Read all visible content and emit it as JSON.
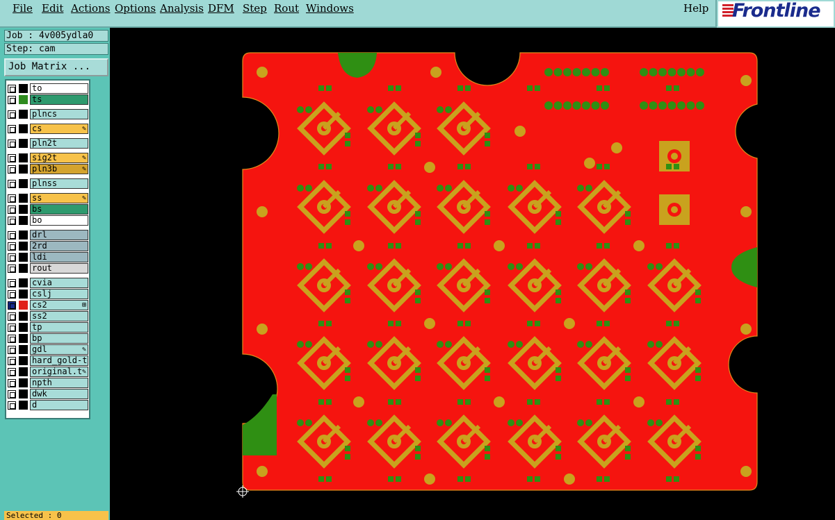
{
  "menu": [
    "File",
    "Edit",
    "Actions",
    "Options",
    "Analysis",
    "DFM",
    "Step",
    "Rout",
    "Windows"
  ],
  "help": "Help",
  "brand": "Frontline",
  "job": "Job : 4v005ydla0",
  "step": "Step: cam",
  "job_matrix": "Job Matrix ...",
  "selected": "Selected : 0",
  "layers": [
    {
      "name": "to",
      "bg": "#ffffff",
      "swatch": "#000000"
    },
    {
      "name": "ts",
      "bg": "#2e9a6e",
      "swatch": "#2e8b1e"
    },
    {
      "name": "plncs",
      "bg": "#a8dcd8",
      "swatch": "#000000"
    },
    {
      "name": "cs",
      "bg": "#f7c24a",
      "swatch": "#000000",
      "mark": "✎"
    },
    {
      "name": "pln2t",
      "bg": "#a8dcd8",
      "swatch": "#000000"
    },
    {
      "name": "sig2t",
      "bg": "#f7c24a",
      "swatch": "#000000",
      "mark": "✎"
    },
    {
      "name": "pln3b",
      "bg": "#d4a32e",
      "swatch": "#000000",
      "mark": "✎"
    },
    {
      "name": "plnss",
      "bg": "#a8dcd8",
      "swatch": "#000000"
    },
    {
      "name": "ss",
      "bg": "#f7c24a",
      "swatch": "#000000",
      "mark": "✎"
    },
    {
      "name": "bs",
      "bg": "#2e9a6e",
      "swatch": "#000000"
    },
    {
      "name": "bo",
      "bg": "#ffffff",
      "swatch": "#000000"
    },
    {
      "name": "drl",
      "bg": "#9cb8c0",
      "swatch": "#000000"
    },
    {
      "name": "2rd",
      "bg": "#9cb8c0",
      "swatch": "#000000"
    },
    {
      "name": "ldi",
      "bg": "#9cb8c0",
      "swatch": "#000000"
    },
    {
      "name": "rout",
      "bg": "#d8d8d8",
      "swatch": "#000000"
    },
    {
      "name": "cvia",
      "bg": "#a8dcd8",
      "swatch": "#000000"
    },
    {
      "name": "cslj",
      "bg": "#a8dcd8",
      "swatch": "#000000"
    },
    {
      "name": "cs2",
      "bg": "#a8dcd8",
      "swatch": "#e0201a",
      "mark": "⊞",
      "active": true
    },
    {
      "name": "ss2",
      "bg": "#a8dcd8",
      "swatch": "#000000"
    },
    {
      "name": "tp",
      "bg": "#a8dcd8",
      "swatch": "#000000"
    },
    {
      "name": "bp",
      "bg": "#a8dcd8",
      "swatch": "#000000"
    },
    {
      "name": "gdl",
      "bg": "#a8dcd8",
      "swatch": "#000000",
      "mark": "✎"
    },
    {
      "name": "hard_gold-t",
      "bg": "#a8dcd8",
      "swatch": "#000000"
    },
    {
      "name": "original.t",
      "bg": "#a8dcd8",
      "swatch": "#000000",
      "mark": "✎"
    },
    {
      "name": "npth",
      "bg": "#a8dcd8",
      "swatch": "#000000"
    },
    {
      "name": "dwk",
      "bg": "#a8dcd8",
      "swatch": "#000000"
    },
    {
      "name": "d",
      "bg": "#a8dcd8",
      "swatch": "#000000"
    }
  ],
  "colors": {
    "board": "#f5140f",
    "copper": "#c9a21e",
    "mask": "#2f8f13"
  }
}
